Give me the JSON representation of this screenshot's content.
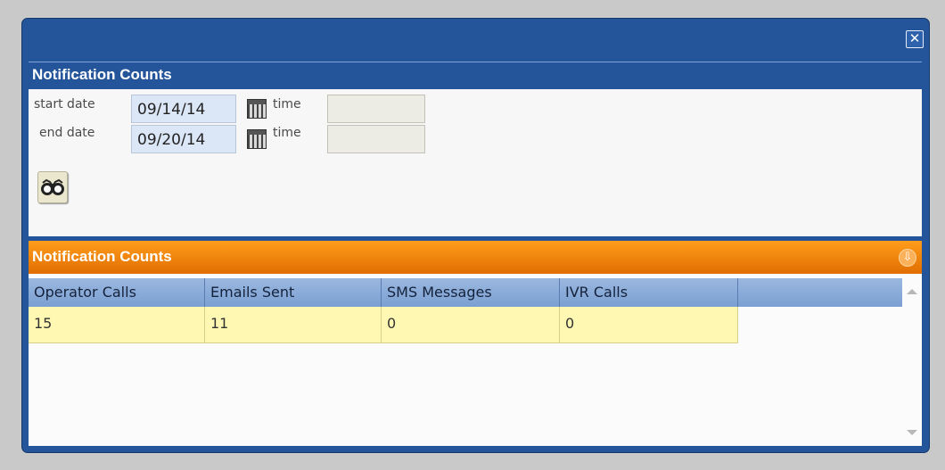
{
  "dialog": {
    "close_icon": "close-icon"
  },
  "filter_panel": {
    "title": "Notification Counts",
    "start_date_label": "start date",
    "start_date_value": "09/14/14",
    "end_date_label": "end date",
    "end_date_value": "09/20/14",
    "time_label": "time",
    "start_time_value": "",
    "end_time_value": "",
    "calendar_icon": "calendar-icon",
    "search_icon": "binoculars-icon"
  },
  "results_panel": {
    "title": "Notification Counts",
    "collapse_icon": "collapse-icon",
    "columns": [
      "Operator Calls",
      "Emails Sent",
      "SMS Messages",
      "IVR Calls"
    ],
    "rows": [
      [
        "15",
        "11",
        "0",
        "0"
      ]
    ]
  },
  "colors": {
    "dialog_blue": "#24549a",
    "header_orange": "#f08a10",
    "row_highlight": "#fff8b3",
    "grid_header": "#8fb0dc"
  }
}
